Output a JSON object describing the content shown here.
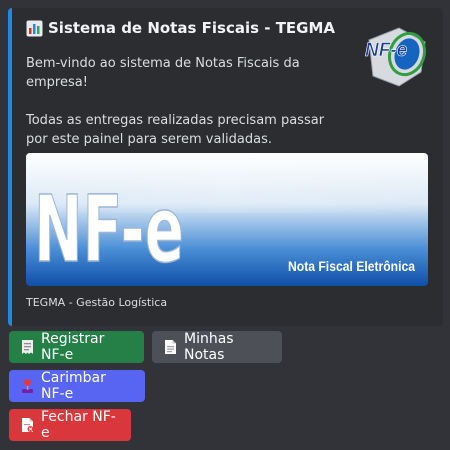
{
  "embed": {
    "accent_color": "#1e88e5",
    "title_icon": "bar-chart-icon",
    "title": "Sistema de Notas Fiscais - TEGMA",
    "description": "Bem-vindo ao sistema de Notas Fiscais da empresa!\n\nTodas as entregas realizadas precisam passar por este painel para serem validadas.",
    "thumbnail_text": "NF-e",
    "banner": {
      "logo_text": "NF-e",
      "subtitle": "Nota Fiscal Eletrônica"
    },
    "footer": "TEGMA - Gestão Logística"
  },
  "buttons": [
    {
      "label": "Registrar NF-e",
      "icon": "receipt-icon",
      "style": "success",
      "color": "#248046"
    },
    {
      "label": "Minhas Notas",
      "icon": "document-icon",
      "style": "secondary",
      "color": "#4e5058"
    },
    {
      "label": "Carimbar NF-e",
      "icon": "joystick-icon",
      "style": "primary",
      "color": "#5865f2"
    },
    {
      "label": "Fechar NF-e",
      "icon": "document-close-icon",
      "style": "danger",
      "color": "#da373c"
    }
  ]
}
